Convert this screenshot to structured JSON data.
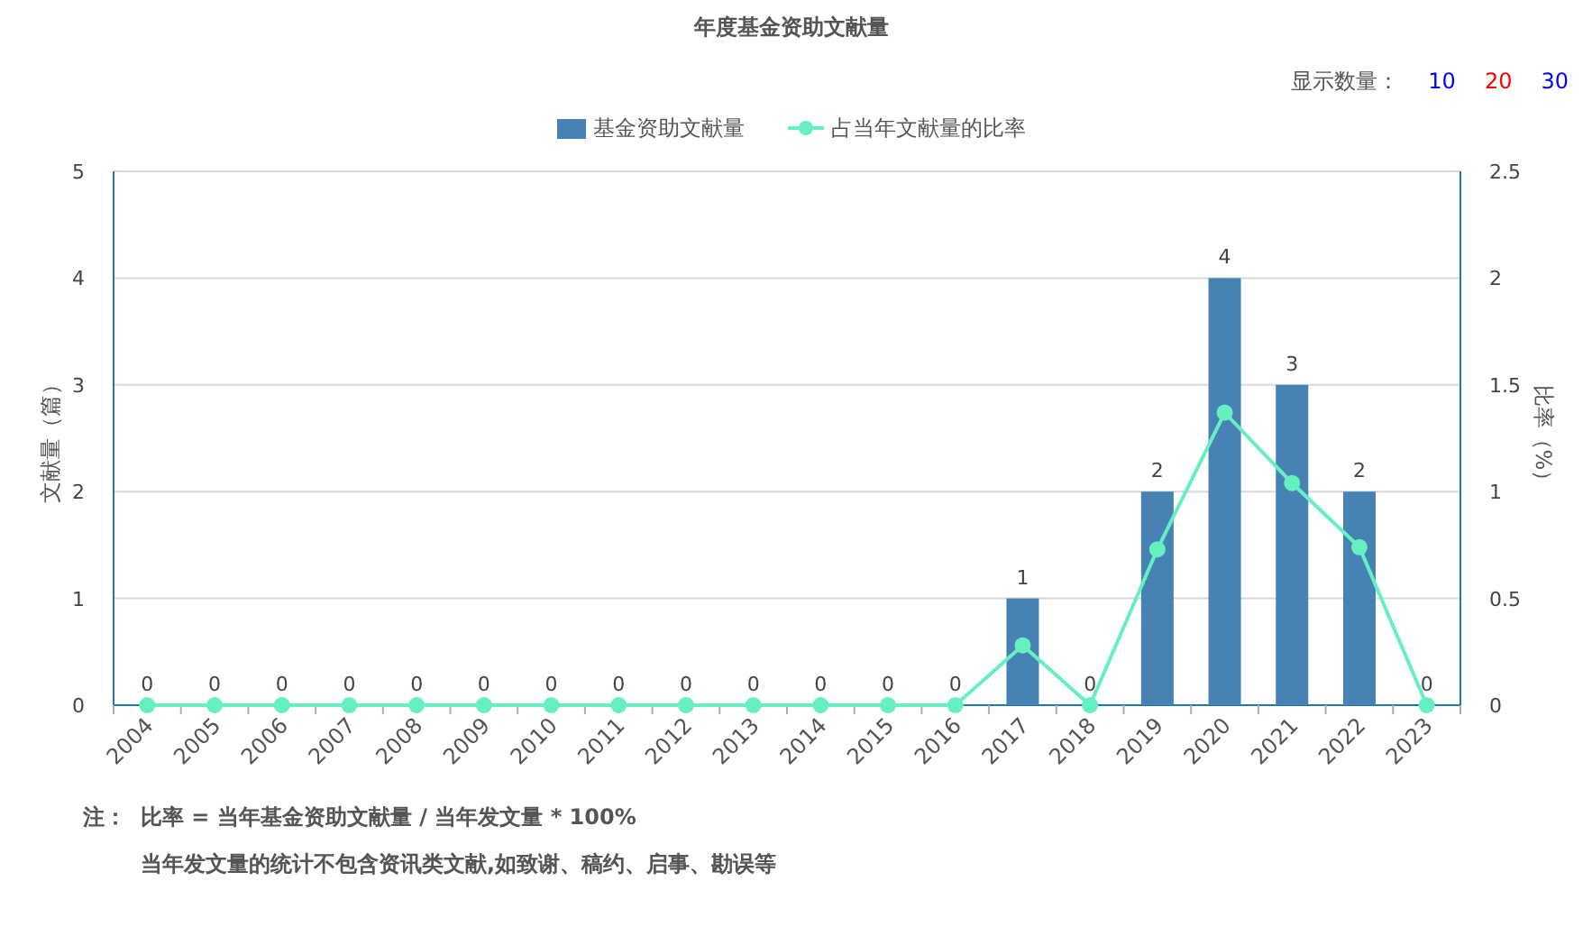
{
  "title": "年度基金资助文献量",
  "display_count": {
    "label": "显示数量：",
    "options": [
      {
        "label": "10",
        "selected": false
      },
      {
        "label": "20",
        "selected": true
      },
      {
        "label": "30",
        "selected": false
      }
    ]
  },
  "chart": {
    "chart_data": {
      "type": "bar",
      "categories": [
        "2004",
        "2005",
        "2006",
        "2007",
        "2008",
        "2009",
        "2010",
        "2011",
        "2012",
        "2013",
        "2014",
        "2015",
        "2016",
        "2017",
        "2018",
        "2019",
        "2020",
        "2021",
        "2022",
        "2023"
      ],
      "series": [
        {
          "name": "基金资助文献量",
          "color": "#4682b4",
          "values": [
            0,
            0,
            0,
            0,
            0,
            0,
            0,
            0,
            0,
            0,
            0,
            0,
            0,
            1,
            0,
            2,
            4,
            3,
            2,
            0
          ],
          "value_labels": [
            "0",
            "0",
            "0",
            "0",
            "0",
            "0",
            "0",
            "0",
            "0",
            "0",
            "0",
            "0",
            "0",
            "1",
            "0",
            "2",
            "4",
            "3",
            "2",
            "0"
          ]
        }
      ],
      "ylabel": "文献量（篇）",
      "ylim": [
        0,
        5
      ],
      "yticks": [
        0,
        1,
        2,
        3,
        4,
        5
      ],
      "grid": true
    }
  },
  "ratio_chart": {
    "chart_data": {
      "type": "line",
      "series": [
        {
          "name": "占当年文献量的比率",
          "color": "#66f0c0",
          "marker": "circle",
          "values": [
            0,
            0,
            0,
            0,
            0,
            0,
            0,
            0,
            0,
            0,
            0,
            0,
            0,
            0.28,
            0,
            0.73,
            1.37,
            1.04,
            0.74,
            0
          ]
        }
      ],
      "ylabel": "比率（%）",
      "ylim": [
        0,
        2.5
      ],
      "yticks": [
        {
          "value": 0,
          "label": "0"
        },
        {
          "value": 0.5,
          "label": "0.5"
        },
        {
          "value": 1,
          "label": "1"
        },
        {
          "value": 1.5,
          "label": "1.5"
        },
        {
          "value": 2,
          "label": "2"
        },
        {
          "value": 2.5,
          "label": "2.5"
        }
      ]
    }
  },
  "notes": {
    "label": "注：",
    "lines": [
      "比率 = 当年基金资助文献量 / 当年发文量 * 100%",
      "当年发文量的统计不包含资讯类文献,如致谢、稿约、启事、勘误等"
    ]
  }
}
